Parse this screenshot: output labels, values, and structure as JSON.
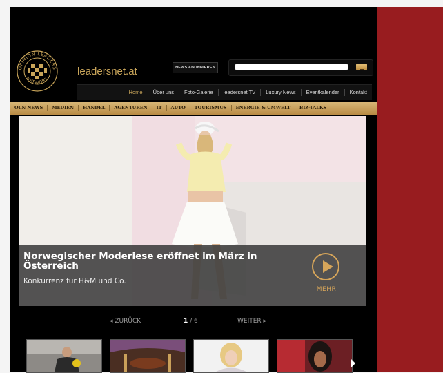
{
  "site": {
    "name": "leadersnet.at",
    "logo_text_top": "OPINION LEADERS",
    "logo_text_bottom": "NETWORK"
  },
  "header": {
    "newsletter_button": "NEWS ABONNIEREN",
    "search": {
      "value": "",
      "placeholder": ""
    }
  },
  "mainnav": [
    {
      "label": "Home",
      "active": true
    },
    {
      "label": "Über uns"
    },
    {
      "label": "Foto-Galerie"
    },
    {
      "label": "leadersnet TV"
    },
    {
      "label": "Luxury News"
    },
    {
      "label": "Eventkalender"
    },
    {
      "label": "Kontakt"
    }
  ],
  "categories": [
    "OLN NEWS",
    "MEDIEN",
    "HANDEL",
    "AGENTUREN",
    "IT",
    "AUTO",
    "TOURISMUS",
    "ENERGIE & UMWELT",
    "BIZ-TALKS"
  ],
  "slider": {
    "title": "Norwegischer Moderiese eröffnet im März in Österreich",
    "subtitle": "Konkurrenz für H&M und Co.",
    "more_label": "MEHR",
    "prev_label": "ZURÜCK",
    "next_label": "WEITER",
    "current": "1",
    "total": "/ 6"
  },
  "colors": {
    "accent": "#c9a55a",
    "right_panel": "#981c1f",
    "page_bg": "#000000"
  }
}
